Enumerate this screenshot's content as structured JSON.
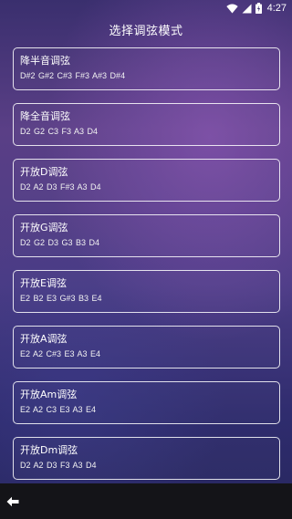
{
  "status_bar": {
    "time": "4:27",
    "icons": [
      "wifi-icon",
      "signal-icon",
      "battery-charging-icon"
    ]
  },
  "header": {
    "title": "选择调弦模式"
  },
  "tunings": [
    {
      "name": "降半音调弦",
      "notes": "D#2  G#2  C#3  F#3  A#3  D#4"
    },
    {
      "name": "降全音调弦",
      "notes": "D2  G2  C3  F3  A3  D4"
    },
    {
      "name": "开放D调弦",
      "notes": "D2  A2  D3  F#3  A3  D4"
    },
    {
      "name": "开放G调弦",
      "notes": "D2  G2  D3  G3  B3  D4"
    },
    {
      "name": "开放E调弦",
      "notes": "E2  B2  E3  G#3  B3  E4"
    },
    {
      "name": "开放A调弦",
      "notes": "E2  A2  C#3  E3  A3  E4"
    },
    {
      "name": "开放Am调弦",
      "notes": "E2  A2  C3  E3  A3  E4"
    },
    {
      "name": "开放Dm调弦",
      "notes": "D2  A2  D3  F3  A3  D4"
    }
  ],
  "bottom_bar": {
    "back_icon": "arrow-left-icon"
  }
}
